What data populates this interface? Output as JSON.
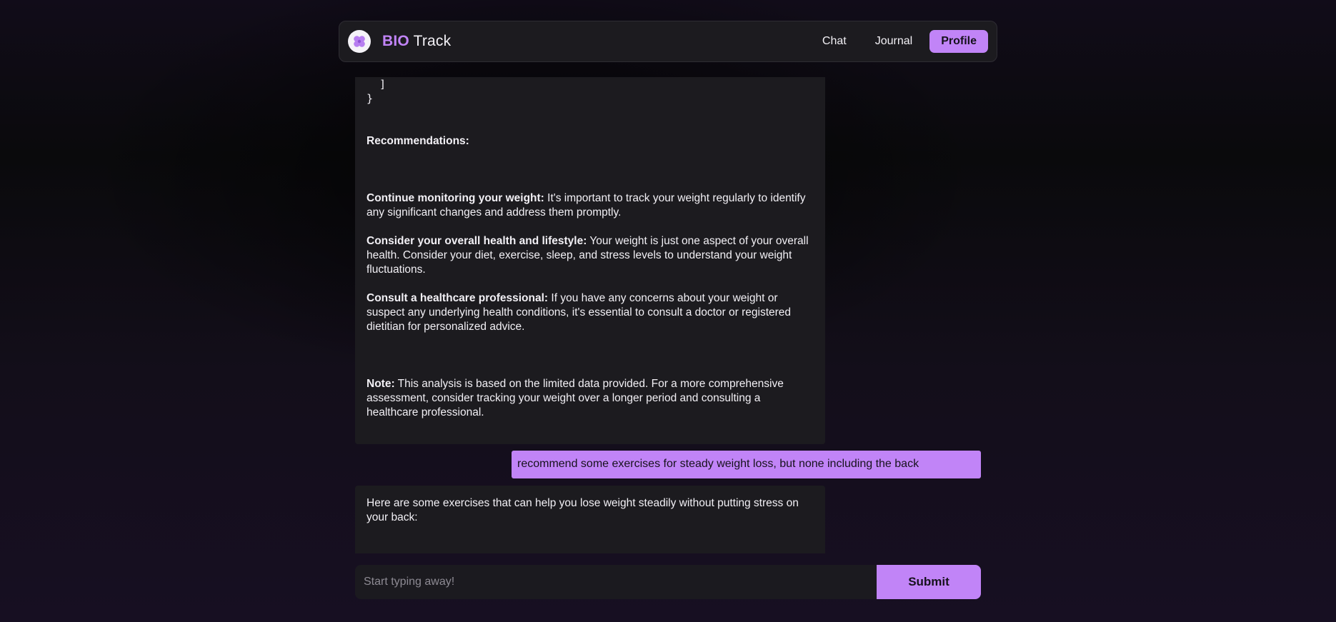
{
  "app": {
    "brand_bold": "BIO",
    "brand_rest": "Track",
    "logo_icon": "flower-icon",
    "accent_color": "#c184f7"
  },
  "nav": {
    "items": [
      {
        "label": "Chat"
      },
      {
        "label": "Journal"
      },
      {
        "label": "Profile",
        "active": true
      }
    ]
  },
  "messages": {
    "assistant1": {
      "code_line1": "  ]",
      "code_line2": "}",
      "recommendations_heading": "Recommendations:",
      "items": [
        {
          "title": "Continue monitoring your weight:",
          "body": "It's important to track your weight regularly to identify any significant changes and address them promptly."
        },
        {
          "title": "Consider your overall health and lifestyle:",
          "body": "Your weight is just one aspect of your overall health. Consider your diet, exercise, sleep, and stress levels to understand your weight fluctuations."
        },
        {
          "title": "Consult a healthcare professional:",
          "body": "If you have any concerns about your weight or suspect any underlying health conditions, it's essential to consult a doctor or registered dietitian for personalized advice."
        }
      ],
      "note_title": "Note:",
      "note_body": "This analysis is based on the limited data provided. For a more comprehensive assessment, consider tracking your weight over a longer period and consulting a healthcare professional."
    },
    "user1": "recommend some exercises for steady weight loss, but none including the back",
    "assistant2": "Here are some exercises that can help you lose weight steadily without putting stress on your back:"
  },
  "composer": {
    "placeholder": "Start typing away!",
    "submit_label": "Submit"
  }
}
